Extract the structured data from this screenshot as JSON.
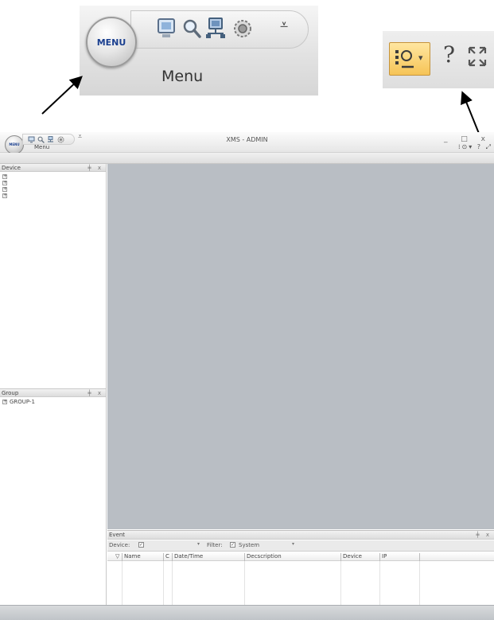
{
  "callouts": {
    "menu_orb_label": "MENU",
    "menu_label": "Menu",
    "quick_access_icons": [
      "monitor-icon",
      "search-icon",
      "network-icon",
      "settings-icon"
    ],
    "right_icons": [
      "layout-icon",
      "help-icon",
      "fullscreen-icon"
    ],
    "help_glyph": "?"
  },
  "app": {
    "title": "XMS - ADMIN",
    "menu_orb_label": "MENU",
    "menu_label": "Menu",
    "window_controls": "_ □ x",
    "right_tools": "⁞⊙▾ ? ⤢"
  },
  "device_panel": {
    "title": "Device",
    "controls": "╪ x",
    "items": [
      "",
      "",
      "",
      ""
    ]
  },
  "group_panel": {
    "title": "Group",
    "controls": "╪ x",
    "items": [
      "GROUP-1"
    ]
  },
  "event_panel": {
    "title": "Event",
    "controls": "╪ x",
    "device_label": "Device:",
    "filter_label": "Filter:",
    "filter_value": "System",
    "columns": [
      "Name",
      "C",
      "Date/Time",
      "Decscription",
      "Device",
      "IP"
    ]
  },
  "colors": {
    "workspace": "#b9bec4",
    "accent_button": "#f6c457",
    "menu_text": "#1a3f8f"
  }
}
